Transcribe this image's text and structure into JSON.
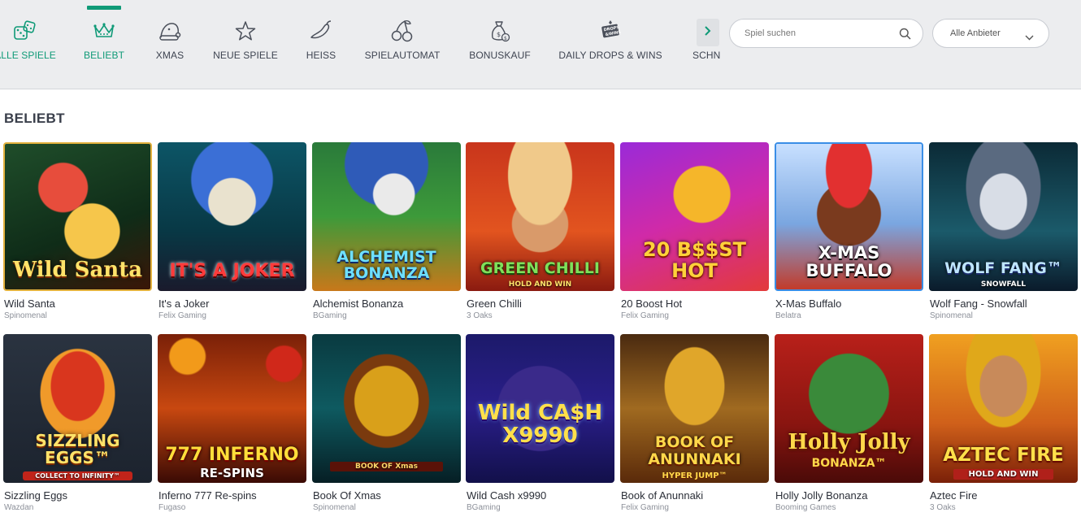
{
  "categories": [
    {
      "label": "ALLE SPIELE",
      "icon": "dice-icon"
    },
    {
      "label": "BELIEBT",
      "icon": "crown-icon",
      "active": true
    },
    {
      "label": "XMAS",
      "icon": "santa-hat-icon"
    },
    {
      "label": "NEUE SPIELE",
      "icon": "star-icon"
    },
    {
      "label": "HEISS",
      "icon": "chili-icon"
    },
    {
      "label": "SPIELAUTOMAT",
      "icon": "cherries-icon"
    },
    {
      "label": "BONUSKAUF",
      "icon": "money-bag-icon"
    },
    {
      "label": "DAILY DROPS & WINS",
      "icon": "drops-wins-icon"
    },
    {
      "label": "SCHNE",
      "icon": "snow-icon"
    }
  ],
  "scroll_icon": "chevron-right-icon",
  "search": {
    "placeholder": "Spiel suchen",
    "value": "",
    "icon": "search-icon"
  },
  "provider_filter": {
    "selected": "Alle Anbieter",
    "icon": "chevron-down-icon"
  },
  "section": {
    "title": "BELIEBT"
  },
  "colors": {
    "accent": "#0f9a77",
    "topbar": "#ecedef"
  },
  "games": [
    {
      "name": "Wild Santa",
      "provider": "Spinomenal",
      "art_title": "Wild Santa",
      "art_sub": ""
    },
    {
      "name": "It's a Joker",
      "provider": "Felix Gaming",
      "art_title": "IT'S A JOKER",
      "art_sub": ""
    },
    {
      "name": "Alchemist Bonanza",
      "provider": "BGaming",
      "art_title": "ALCHEMIST BONANZA",
      "art_sub": ""
    },
    {
      "name": "Green Chilli",
      "provider": "3 Oaks",
      "art_title": "GREEN CHILLI",
      "art_sub": "HOLD AND WIN"
    },
    {
      "name": "20 Boost Hot",
      "provider": "Felix Gaming",
      "art_title": "20 B$$ST HOT",
      "art_sub": ""
    },
    {
      "name": "X-Mas Buffalo",
      "provider": "Belatra",
      "art_title": "X-MAS BUFFALO",
      "art_sub": ""
    },
    {
      "name": "Wolf Fang - Snowfall",
      "provider": "Spinomenal",
      "art_title": "WOLF FANG™",
      "art_sub": "SNOWFALL"
    },
    {
      "name": "Sizzling Eggs",
      "provider": "Wazdan",
      "art_title": "SIZZLING EGGS™",
      "art_sub": "COLLECT TO INFINITY™"
    },
    {
      "name": "Inferno 777 Re-spins",
      "provider": "Fugaso",
      "art_title": "777 INFERNO",
      "art_sub": "RE-SPINS"
    },
    {
      "name": "Book Of Xmas",
      "provider": "Spinomenal",
      "art_title": "",
      "art_sub": "BOOK OF Xmas"
    },
    {
      "name": "Wild Cash x9990",
      "provider": "BGaming",
      "art_title": "Wild CA$H X9990",
      "art_sub": ""
    },
    {
      "name": "Book of Anunnaki",
      "provider": "Felix Gaming",
      "art_title": "BOOK OF ANUNNAKI",
      "art_sub": "HYPER JUMP™"
    },
    {
      "name": "Holly Jolly Bonanza",
      "provider": "Booming Games",
      "art_title": "Holly Jolly",
      "art_sub": "BONANZA™"
    },
    {
      "name": "Aztec Fire",
      "provider": "3 Oaks",
      "art_title": "AZTEC FIRE",
      "art_sub": "HOLD AND WIN"
    }
  ]
}
